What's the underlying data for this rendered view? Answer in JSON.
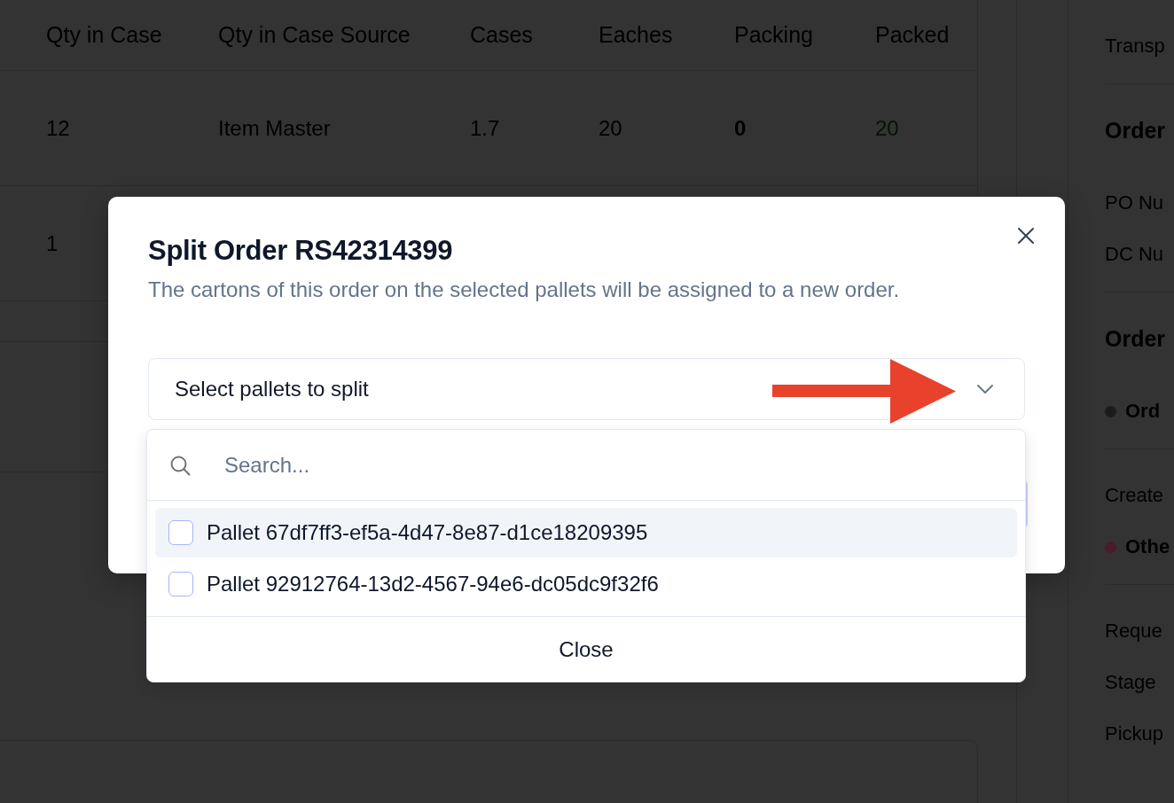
{
  "table": {
    "columns": [
      {
        "label": "Qty in Case",
        "kind": "plain"
      },
      {
        "label": "Qty in Case Source",
        "kind": "plain"
      },
      {
        "label": "Cases",
        "kind": "plain"
      },
      {
        "label": "Eaches",
        "kind": "plain"
      },
      {
        "label": "Packing",
        "kind": "bold"
      },
      {
        "label": "Packed",
        "kind": "success"
      }
    ],
    "rows": [
      {
        "cells": [
          "12",
          "Item Master",
          "1.7",
          "20",
          "0",
          "20"
        ]
      },
      {
        "cells": [
          "1"
        ]
      }
    ]
  },
  "details": {
    "sections": [
      {
        "items": [
          {
            "kind": "label",
            "text": "Transp"
          }
        ]
      },
      {
        "items": [
          {
            "kind": "heading",
            "text": "Order"
          },
          {
            "kind": "label",
            "text": "PO Nu"
          },
          {
            "kind": "label",
            "text": "DC Nu"
          }
        ]
      },
      {
        "items": [
          {
            "kind": "heading",
            "text": "Order"
          },
          {
            "kind": "status",
            "text": "Ord",
            "color": "#1c1c1c"
          }
        ]
      },
      {
        "items": [
          {
            "kind": "label",
            "text": "Create"
          },
          {
            "kind": "status",
            "text": "Othe",
            "color": "#4a1c2b"
          }
        ]
      },
      {
        "items": [
          {
            "kind": "label",
            "text": "Reque"
          },
          {
            "kind": "label",
            "text": "Stage"
          },
          {
            "kind": "label",
            "text": "Pickup"
          }
        ]
      }
    ]
  },
  "dialog": {
    "title": "Split Order RS42314399",
    "description": "The cartons of this order on the selected pallets will be assigned to a new order.",
    "pallet_select": {
      "label": "Select pallets to split",
      "expanded": true,
      "search": {
        "placeholder": "Search..."
      },
      "options": [
        {
          "label": "Pallet 67df7ff3-ef5a-4d47-8e87-d1ce18209395",
          "highlighted": true,
          "checked": false
        },
        {
          "label": "Pallet 92912764-13d2-4567-94e6-dc05dc9f32f6",
          "highlighted": false,
          "checked": false
        }
      ],
      "close_label": "Close"
    }
  }
}
